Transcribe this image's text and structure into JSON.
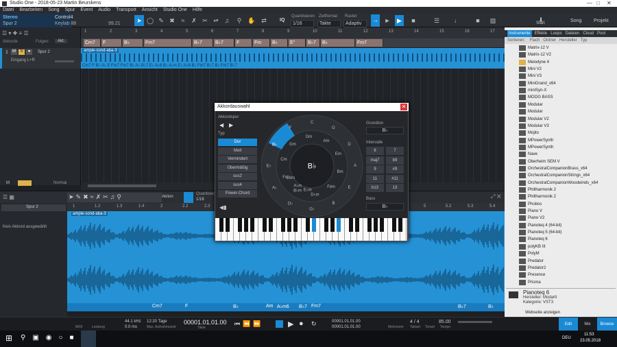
{
  "window": {
    "title": "Studio One - 2018-05-23 Martin Beurskens"
  },
  "menu": [
    "Datei",
    "Bearbeiten",
    "Song",
    "Spur",
    "Event",
    "Audio",
    "Transport",
    "Ansicht",
    "Studio One",
    "Hilfe"
  ],
  "toolbar": {
    "track_name": "Stereo",
    "track_sub": "Spur 2",
    "device": "Control4",
    "keylab": "Keylab 88",
    "cpu": "99.21",
    "quantize_label": "Quantisieren",
    "quantize_val": "1/16",
    "timebase_label": "Zeitformat",
    "timebase_val": "Takte",
    "snap_label": "Raster",
    "snap_val": "Adaptiv",
    "iq": "IQ",
    "start": "Start",
    "song": "Song",
    "projekt": "Projekt"
  },
  "arrangement": {
    "chord_track_label": "Akkorde",
    "follow_label": "Folgen:",
    "follow_val": "Akt.",
    "track_num": "1",
    "track_name": "Spur 2",
    "input": "Eingang L+R",
    "clip_name": "ample-sond-aba-3",
    "ruler": [
      "1",
      "2",
      "3",
      "4",
      "5",
      "6",
      "7",
      "8",
      "9",
      "10",
      "11",
      "12",
      "13",
      "14",
      "15",
      "16",
      "17"
    ],
    "chords": [
      "Cm7",
      "F",
      "B♭",
      "Fm7",
      "B♭7",
      "B♭7",
      "F",
      "Fm",
      "B♭",
      "E°",
      "B♭7",
      "B♭",
      "Fm7"
    ],
    "clip_chords": "Cm7  F  B♭  A♭  E  Fm7   Fm7  B♭  A♭  B♭7  E♭  A♭6   B♭  A♭m  E♭  A♭6  B♭  Fm7  B♭7  B♭  Fm7  B♭7",
    "bottom_left": "M",
    "normal": "Normal"
  },
  "browser": {
    "tabs": [
      "Instrumente",
      "Effekte",
      "Loops",
      "Dateien",
      "Cloud",
      "Pool"
    ],
    "sort_label": "Sortieren:",
    "sort_opts": [
      "Flach",
      "Ordner",
      "Hersteller",
      "Typ"
    ],
    "items": [
      "Matrix-12 V",
      "Matrix-12 V2",
      "Melodyne 4",
      "Mini V2",
      "Mini V3",
      "MiniGrand_x64",
      "miniSyn-X",
      "MOOG BASS",
      "Modular",
      "Modular",
      "Modular V2",
      "Modular V3",
      "Mojito",
      "MPowerSynth",
      "MPowerSynth",
      "Nave",
      "Oberheim SEM V",
      "OrchestralCompanionBrass_x64",
      "OrchestralCompanionStrings_x64",
      "OrchestralCompanionWoodwinds_x64",
      "Phillharmonik 2",
      "Phillharmonik 2",
      "Phobos",
      "Piano V",
      "Piano V2",
      "Pianoteq 4 (64-bit)",
      "Pianoteq 5 (64-bit)",
      "Pianoteq 6",
      "polyKB III",
      "PolyM",
      "Predator",
      "Predator2",
      "Presence",
      "Prisma"
    ],
    "sel_name": "Pianoteq 6",
    "sel_vendor": "Hersteller:  Modartt",
    "sel_cat": "Kategorie:  VST3",
    "website": "Webseite anzeigen",
    "edit": "Edit",
    "mix": "Mix",
    "browse": "Browse"
  },
  "editor": {
    "track": "Spur 2",
    "aktion": "Aktion",
    "quantize": "Quantisieren",
    "quantize_val": "1/16",
    "no_chord": "Kein Akkord ausgewählt",
    "clip_name": "ample-sond-aba-3",
    "ruler": [
      "1",
      "1.2",
      "1.3",
      "1.4",
      "2",
      "2.2",
      "2.3",
      "2.4",
      "3",
      "3.2",
      "3.3",
      "3.4",
      "4",
      "4.2",
      "4.3",
      "4.4",
      "5",
      "5.2",
      "5.3",
      "5.4"
    ],
    "chords": [
      "Cm7",
      "F",
      "B♭",
      "Am",
      "A♭m6",
      "B♭7",
      "Fm7",
      "B♭7",
      "B♭"
    ]
  },
  "dialog": {
    "title": "Akkordauswahl",
    "chordtrack": "Akkordspur",
    "typ": "Typ",
    "types": [
      "Dur",
      "Moll",
      "Vermindert",
      "Übermäßig",
      "sus2",
      "sus4",
      "Power-Chord"
    ],
    "root_label": "Grundton",
    "root_val": "B♭",
    "intervals_label": "Intervalle",
    "intervals": [
      "6",
      "7",
      "maj7",
      "b9",
      "9",
      "#9",
      "11",
      "#11",
      "b13",
      "13"
    ],
    "bass_label": "Bass",
    "bass_val": "B♭",
    "center": "B♭",
    "outer": [
      "C",
      "G",
      "D",
      "A",
      "E",
      "B",
      "G♭",
      "D♭",
      "A♭",
      "E♭",
      "B♭",
      "F"
    ],
    "inner": [
      "Am",
      "Em",
      "Bm",
      "F♯m",
      "D♭m",
      "B♭m",
      "Fm",
      "Cm",
      "Gm",
      "Dm"
    ],
    "inner2": [
      "E♭m",
      "A♭m",
      "Ebm"
    ]
  },
  "transport": {
    "midi": "MIDI",
    "latency": "Leistung",
    "rate": "44.1 kHz",
    "ms": "0.0 ms",
    "days": "12:20 Tage",
    "rec": "Max. Aufnahmezeit",
    "time": "00001.01.01.00",
    "time_lbl": "Takte",
    "loop_l": "00001.01.01.00",
    "loop_r": "00001.01.01.00",
    "metronom": "Metronom",
    "sig": "4 / 4",
    "sig_lbl": "Taktart",
    "tonart": "Tonart",
    "tempo": "85.00",
    "tempo_lbl": "Tempo"
  },
  "taskbar": {
    "time": "11:53",
    "date": "23.05.2018",
    "lang": "DEU"
  }
}
